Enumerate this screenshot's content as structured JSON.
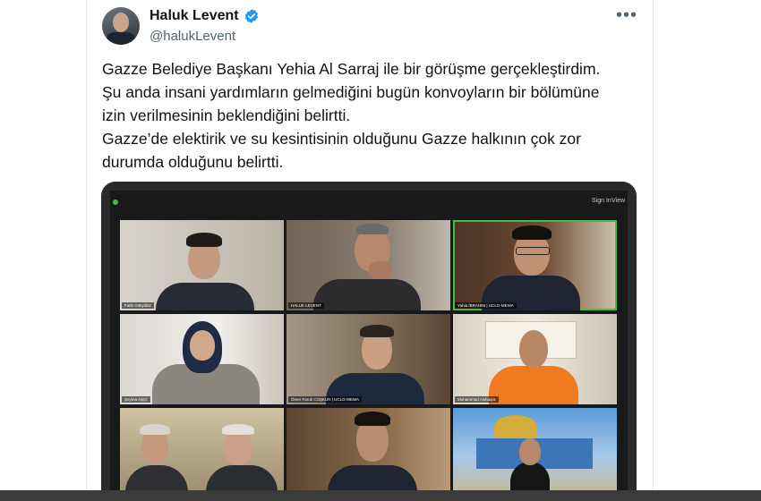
{
  "author": {
    "name": "Haluk Levent",
    "handle": "@halukLevent",
    "verified": true,
    "verified_color": "#1d9bf0"
  },
  "tweet_lines": [
    "Gazze Belediye Başkanı Yehia Al Sarraj ile bir görüşme gerçekleştirdim.",
    "Şu anda insani yardımların gelmediğini bugün konvoyların bir bölümüne",
    "izin verilmesinin beklendiğini belirtti.",
    "Gazze’de elektirik ve su kesintisinin olduğunu Gazze halkının çok zor",
    "durumda olduğunu belirtti."
  ],
  "icons": {
    "more": "more-horizontal-icon",
    "verified": "verified-badge-icon"
  },
  "video_call": {
    "top_right": [
      "Sign In",
      "View"
    ],
    "active_speaker_color": "#3ec13e",
    "participants": [
      {
        "label": "Fatih Gökyıldız",
        "active": false
      },
      {
        "label": "HALUK LEVENT",
        "active": false
      },
      {
        "label": "Yahia İBRAHİM | UCLG-MEWA",
        "active": true
      },
      {
        "label": "Şeyma AŞÇI",
        "active": false
      },
      {
        "label": "Ömer Faruk COŞKUN | UCLG-MEWA",
        "active": false
      },
      {
        "label": "Mohammad Alshaqra",
        "active": false
      },
      {
        "label": "",
        "active": false
      },
      {
        "label": "",
        "active": false
      },
      {
        "label": "",
        "active": false
      }
    ]
  }
}
